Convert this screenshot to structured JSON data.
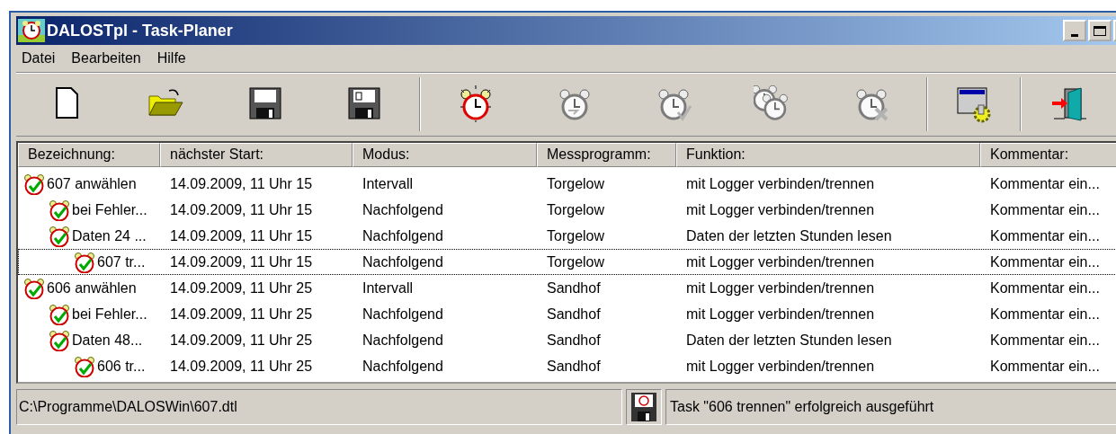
{
  "window": {
    "title": "DALOSTpl - Task-Planer"
  },
  "menu": [
    "Datei",
    "Bearbeiten",
    "Hilfe"
  ],
  "toolbar": {
    "groups": [
      [
        {
          "kind": "new",
          "disabled": false
        },
        {
          "kind": "open",
          "disabled": false
        },
        {
          "kind": "save",
          "disabled": false
        },
        {
          "kind": "saveas",
          "disabled": false
        }
      ],
      [
        {
          "kind": "alarm",
          "disabled": false
        },
        {
          "kind": "alarm-run",
          "disabled": true
        },
        {
          "kind": "alarm-check",
          "disabled": true
        },
        {
          "kind": "alarm-multi",
          "disabled": true
        },
        {
          "kind": "alarm-delete",
          "disabled": true
        }
      ],
      [
        {
          "kind": "settings",
          "disabled": false
        }
      ],
      [
        {
          "kind": "exit",
          "disabled": false
        }
      ]
    ]
  },
  "table": {
    "columns": [
      "Bezeichnung:",
      "nächster Start:",
      "Modus:",
      "Messprogramm:",
      "Funktion:",
      "Kommentar:"
    ],
    "rows": [
      {
        "cells": [
          "607 anwählen",
          "14.09.2009, 11 Uhr 15",
          "Intervall",
          "Torgelow",
          "mit Logger verbinden/trennen",
          "Kommentar ein..."
        ],
        "focused": false,
        "children": [
          {
            "cells": [
              "bei Fehler...",
              "14.09.2009, 11 Uhr 15",
              "Nachfolgend",
              "Torgelow",
              "mit Logger verbinden/trennen",
              "Kommentar ein..."
            ],
            "focused": false
          },
          {
            "cells": [
              "Daten 24 ...",
              "14.09.2009, 11 Uhr 15",
              "Nachfolgend",
              "Torgelow",
              "Daten der letzten Stunden lesen",
              "Kommentar ein..."
            ],
            "focused": false,
            "children": [
              {
                "cells": [
                  "607 tr...",
                  "14.09.2009, 11 Uhr 15",
                  "Nachfolgend",
                  "Torgelow",
                  "mit Logger verbinden/trennen",
                  "Kommentar ein..."
                ],
                "focused": true
              }
            ]
          }
        ]
      },
      {
        "cells": [
          "606 anwählen",
          "14.09.2009, 11 Uhr 25",
          "Intervall",
          "Sandhof",
          "mit Logger verbinden/trennen",
          "Kommentar ein..."
        ],
        "focused": false,
        "children": [
          {
            "cells": [
              "bei Fehler...",
              "14.09.2009, 11 Uhr 25",
              "Nachfolgend",
              "Sandhof",
              "mit Logger verbinden/trennen",
              "Kommentar ein..."
            ],
            "focused": false
          },
          {
            "cells": [
              "Daten 48...",
              "14.09.2009, 11 Uhr 25",
              "Nachfolgend",
              "Sandhof",
              "Daten der letzten Stunden lesen",
              "Kommentar ein..."
            ],
            "focused": false,
            "children": [
              {
                "cells": [
                  "606 tr...",
                  "14.09.2009, 11 Uhr 25",
                  "Nachfolgend",
                  "Sandhof",
                  "mit Logger verbinden/trennen",
                  "Kommentar ein..."
                ],
                "focused": false
              }
            ]
          }
        ]
      }
    ]
  },
  "status_bar": {
    "path": "C:\\Programme\\DALOSWin\\607.dtl",
    "message": "Task \"606 trennen\" erfolgreich ausgeführt"
  }
}
